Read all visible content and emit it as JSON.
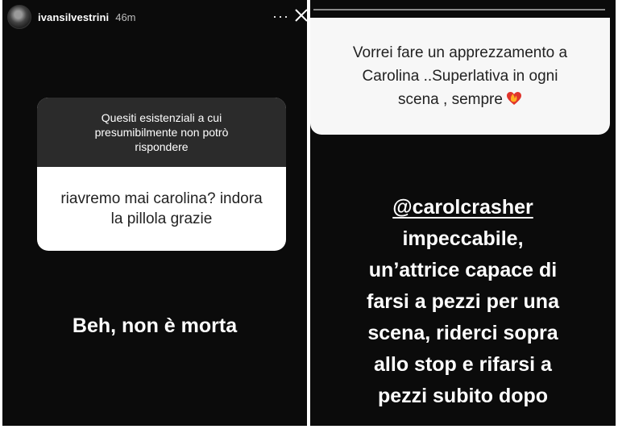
{
  "left_story": {
    "username": "ivansilvestrini",
    "timestamp": "46m",
    "more_label": "···",
    "question": {
      "prompt": "Quesiti esistenziali a cui presumibilmente non potrò rispondere",
      "answer": "riavremo mai carolina? indora la pillola grazie"
    },
    "reply": "Beh, non è morta"
  },
  "right_story": {
    "card_text": "Vorrei fare un apprezzamento a Carolina ..Superlativa in ogni scena , sempre",
    "card_emoji": "heart-on-fire",
    "mention": "@carolcrasher",
    "reply_lines": [
      "impeccabile,",
      "un’attrice capace di",
      "farsi a pezzi per una",
      "scena, riderci sopra",
      "allo stop e rifarsi a",
      "pezzi subito dopo"
    ]
  },
  "colors": {
    "story_bg": "#0b0b0b",
    "question_head": "#2b2b2b",
    "card_bg": "#f7f7f7",
    "text_light": "#ffffff",
    "text_dark": "#222222"
  }
}
